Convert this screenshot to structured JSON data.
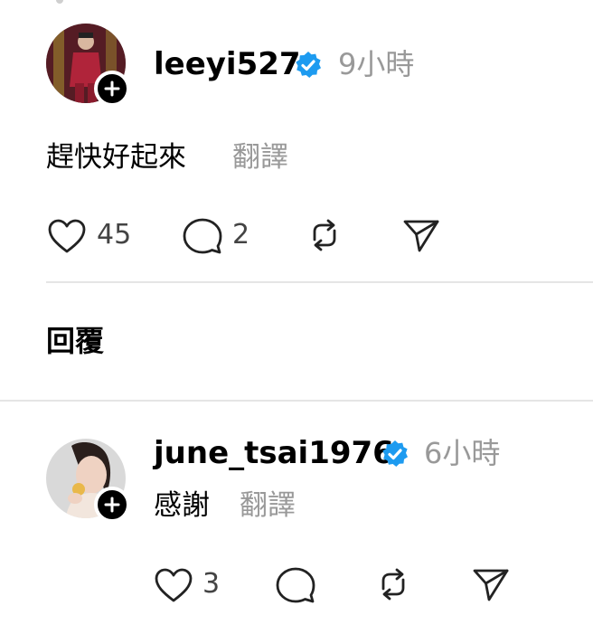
{
  "post": {
    "username": "leeyi527",
    "timestamp": "9小時",
    "text": "趕快好起來",
    "translate_label": "翻譯",
    "like_count": "45",
    "comment_count": "2",
    "icons": [
      "heart-icon",
      "comment-icon",
      "repost-icon",
      "share-icon"
    ]
  },
  "replies_header": {
    "title": "回覆"
  },
  "reply": {
    "username": "june_tsai1976",
    "timestamp": "6小時",
    "text": "感謝",
    "translate_label": "翻譯",
    "like_count": "3",
    "icons": [
      "heart-icon",
      "comment-icon",
      "repost-icon",
      "share-icon"
    ]
  },
  "colors": {
    "verified_blue": "#1d9bf0",
    "muted_text": "#999999",
    "divider": "#e5e5e5",
    "avatar1_bg": "#6b1f2a",
    "avatar2_bg": "#d9d9d9"
  }
}
